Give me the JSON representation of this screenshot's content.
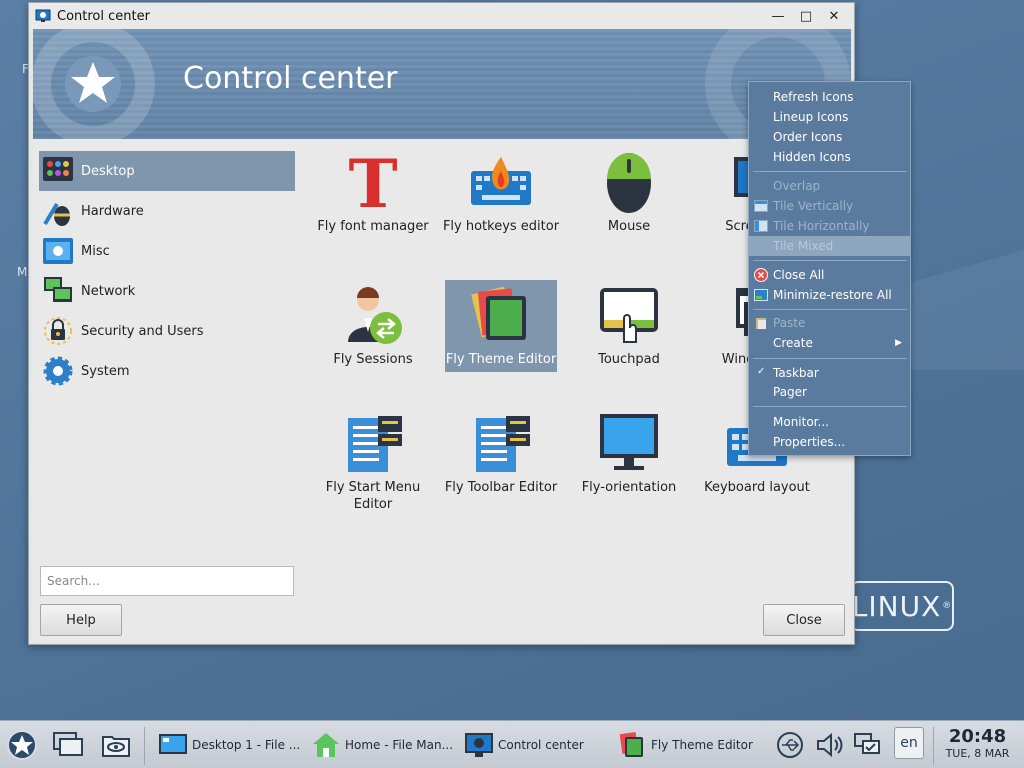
{
  "window": {
    "title": "Control center",
    "banner_title": "Control center"
  },
  "sidebar": {
    "items": [
      {
        "label": "Desktop",
        "icon": "desktop-icon",
        "selected": true
      },
      {
        "label": "Hardware",
        "icon": "hardware-icon",
        "selected": false
      },
      {
        "label": "Misc",
        "icon": "misc-icon",
        "selected": false
      },
      {
        "label": "Network",
        "icon": "network-icon",
        "selected": false
      },
      {
        "label": "Security and Users",
        "icon": "security-icon",
        "selected": false
      },
      {
        "label": "System",
        "icon": "system-gear-icon",
        "selected": false
      }
    ]
  },
  "search": {
    "placeholder": "Search..."
  },
  "buttons": {
    "help": "Help",
    "close": "Close"
  },
  "tiles": [
    {
      "label": "Fly font manager",
      "icon": "font-t-icon"
    },
    {
      "label": "Fly hotkeys editor",
      "icon": "keyboard-fire-icon"
    },
    {
      "label": "Mouse",
      "icon": "mouse-icon"
    },
    {
      "label": "Screen se",
      "icon": "screen-gear-icon"
    },
    {
      "label": "Fly Sessions",
      "icon": "sessions-user-icon"
    },
    {
      "label": "Fly Theme Editor",
      "icon": "theme-editor-icon",
      "selected": true
    },
    {
      "label": "Touchpad",
      "icon": "touchpad-icon"
    },
    {
      "label": "Windows p",
      "icon": "windows-icon"
    },
    {
      "label": "Fly Start Menu",
      "label2": "Editor",
      "icon": "start-menu-editor-icon"
    },
    {
      "label": "Fly Toolbar Editor",
      "icon": "toolbar-editor-icon"
    },
    {
      "label": "Fly-orientation",
      "icon": "monitor-icon"
    },
    {
      "label": "Keyboard layout",
      "icon": "keyboard-icon"
    }
  ],
  "context_menu": {
    "items": [
      {
        "label": "Refresh Icons",
        "disabled": false
      },
      {
        "label": "Lineup Icons",
        "disabled": false
      },
      {
        "label": "Order Icons",
        "disabled": false
      },
      {
        "label": "Hidden Icons",
        "disabled": false
      },
      {
        "label": "Overlap",
        "disabled": true
      },
      {
        "label": "Tile Vertically",
        "disabled": true,
        "icon": "tile-vertical-icon"
      },
      {
        "label": "Tile Horizontally",
        "disabled": true,
        "icon": "tile-horizontal-icon"
      },
      {
        "label": "Tile Mixed",
        "disabled": true,
        "highlighted": true
      },
      {
        "label": "Close All",
        "disabled": false,
        "icon": "close-all-icon"
      },
      {
        "label": "Minimize-restore All",
        "disabled": false,
        "icon": "minimize-all-icon"
      },
      {
        "label": "Paste",
        "disabled": true,
        "icon": "paste-icon"
      },
      {
        "label": "Create",
        "disabled": false,
        "submenu": true
      },
      {
        "label": "Taskbar",
        "disabled": false,
        "checked": true
      },
      {
        "label": "Pager",
        "disabled": false
      },
      {
        "label": "Monitor...",
        "disabled": false
      },
      {
        "label": "Properties...",
        "disabled": false
      }
    ]
  },
  "taskbar": {
    "tasks": [
      {
        "label": "Desktop 1 - File ...",
        "icon": "desktop-file-icon"
      },
      {
        "label": "Home - File Man...",
        "icon": "home-icon"
      },
      {
        "label": "Control center",
        "icon": "control-center-icon"
      },
      {
        "label": "Fly Theme Editor",
        "icon": "theme-editor-icon"
      }
    ],
    "language": "en",
    "time": "20:48",
    "date": "TUE, 8 MAR"
  },
  "desktop": {
    "logo_text": "LINUX",
    "logo_mark": "®"
  },
  "colors": {
    "desktop_bg": "#5b7fa6",
    "selection": "#7f96ad",
    "menu_bg": "#5a7b9e"
  }
}
